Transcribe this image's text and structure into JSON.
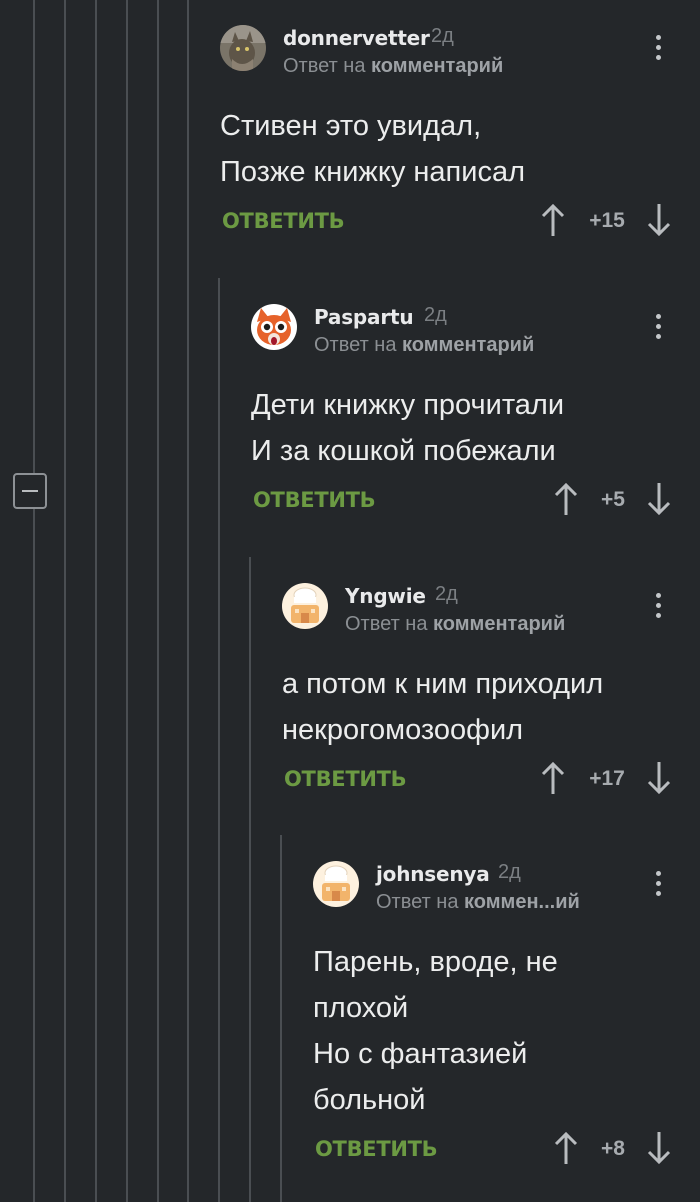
{
  "comments": [
    {
      "username": "donnervetter",
      "time": "2д",
      "reply_prefix": "Ответ на",
      "reply_link": "комментарий",
      "text_lines": [
        "Стивен это увидал,",
        "Позже книжку написал"
      ],
      "reply_label": "ОТВЕТИТЬ",
      "rating": "+15"
    },
    {
      "username": "Paspartu",
      "time": "2д",
      "reply_prefix": "Ответ на",
      "reply_link": "комментарий",
      "text_lines": [
        "Дети книжку прочитали",
        "И за кошкой побежали"
      ],
      "reply_label": "ОТВЕТИТЬ",
      "rating": "+5"
    },
    {
      "username": "Yngwie",
      "time": "2д",
      "reply_prefix": "Ответ на",
      "reply_link": "комментарий",
      "text_lines": [
        "а потом к ним приходил",
        "некрогомозоофил"
      ],
      "reply_label": "ОТВЕТИТЬ",
      "rating": "+17"
    },
    {
      "username": "johnsenya",
      "time": "2д",
      "reply_prefix": "Ответ на",
      "reply_link": "коммен...ий",
      "text_lines": [
        "Парень, вроде, не",
        "плохой",
        "Но с фантазией",
        "больной"
      ],
      "reply_label": "ОТВЕТИТЬ",
      "rating": "+8"
    }
  ],
  "colors": {
    "background": "#24272a",
    "reply_green": "#6c9a43",
    "thread_line": "#4a4e52"
  }
}
